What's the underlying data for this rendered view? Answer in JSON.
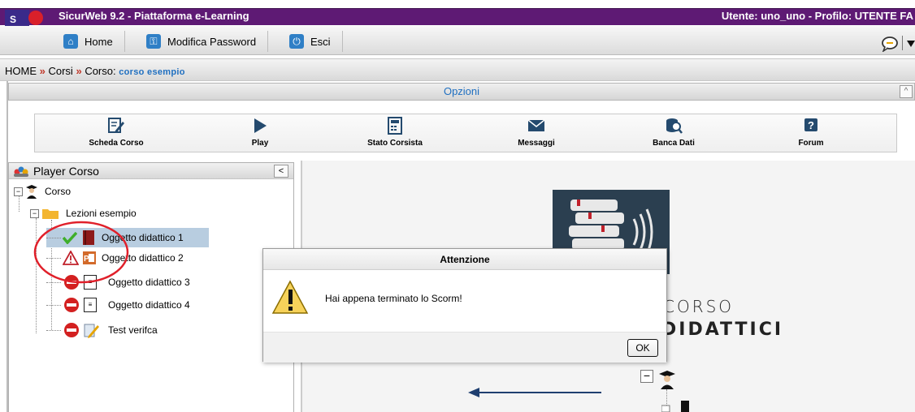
{
  "window": {
    "app_title": "SicurWeb 9.2 - Piattaforma e-Learning",
    "user_info": "Utente: uno_uno - Profilo: UTENTE FA"
  },
  "menu": {
    "home": "Home",
    "change_password": "Modifica Password",
    "exit": "Esci"
  },
  "breadcrumb": {
    "home": "HOME",
    "sep": "»",
    "courses": "Corsi",
    "course_prefix": "Corso:",
    "current": "corso esempio"
  },
  "options": {
    "title": "Opzioni",
    "collapse_glyph": "^"
  },
  "toolbar": [
    {
      "label": "Scheda Corso",
      "icon": "edit-sheet-icon"
    },
    {
      "label": "Play",
      "icon": "play-icon"
    },
    {
      "label": "Stato Corsista",
      "icon": "calculator-icon"
    },
    {
      "label": "Messaggi",
      "icon": "envelope-icon"
    },
    {
      "label": "Banca Dati",
      "icon": "database-search-icon"
    },
    {
      "label": "Forum",
      "icon": "help-icon"
    }
  ],
  "player": {
    "title": "Player Corso",
    "back_glyph": "<",
    "root": "Corso",
    "folder": "Lezioni esempio",
    "items": [
      {
        "label": "Oggetto didattico 1",
        "status": "completed"
      },
      {
        "label": "Oggetto didattico 2",
        "status": "warning"
      },
      {
        "label": "Oggetto didattico 3",
        "status": "locked"
      },
      {
        "label": "Oggetto didattico 4",
        "status": "locked"
      },
      {
        "label": "Test verifca",
        "status": "locked"
      }
    ]
  },
  "content": {
    "line1": "CORSO",
    "line2": "DIDATTICI"
  },
  "dialog": {
    "title": "Attenzione",
    "message": "Hai appena terminato lo Scorm!",
    "ok": "OK"
  },
  "colors": {
    "title_bar": "#5e1a74",
    "link_blue": "#1f6fc0",
    "annotation_red": "#e0202a"
  }
}
